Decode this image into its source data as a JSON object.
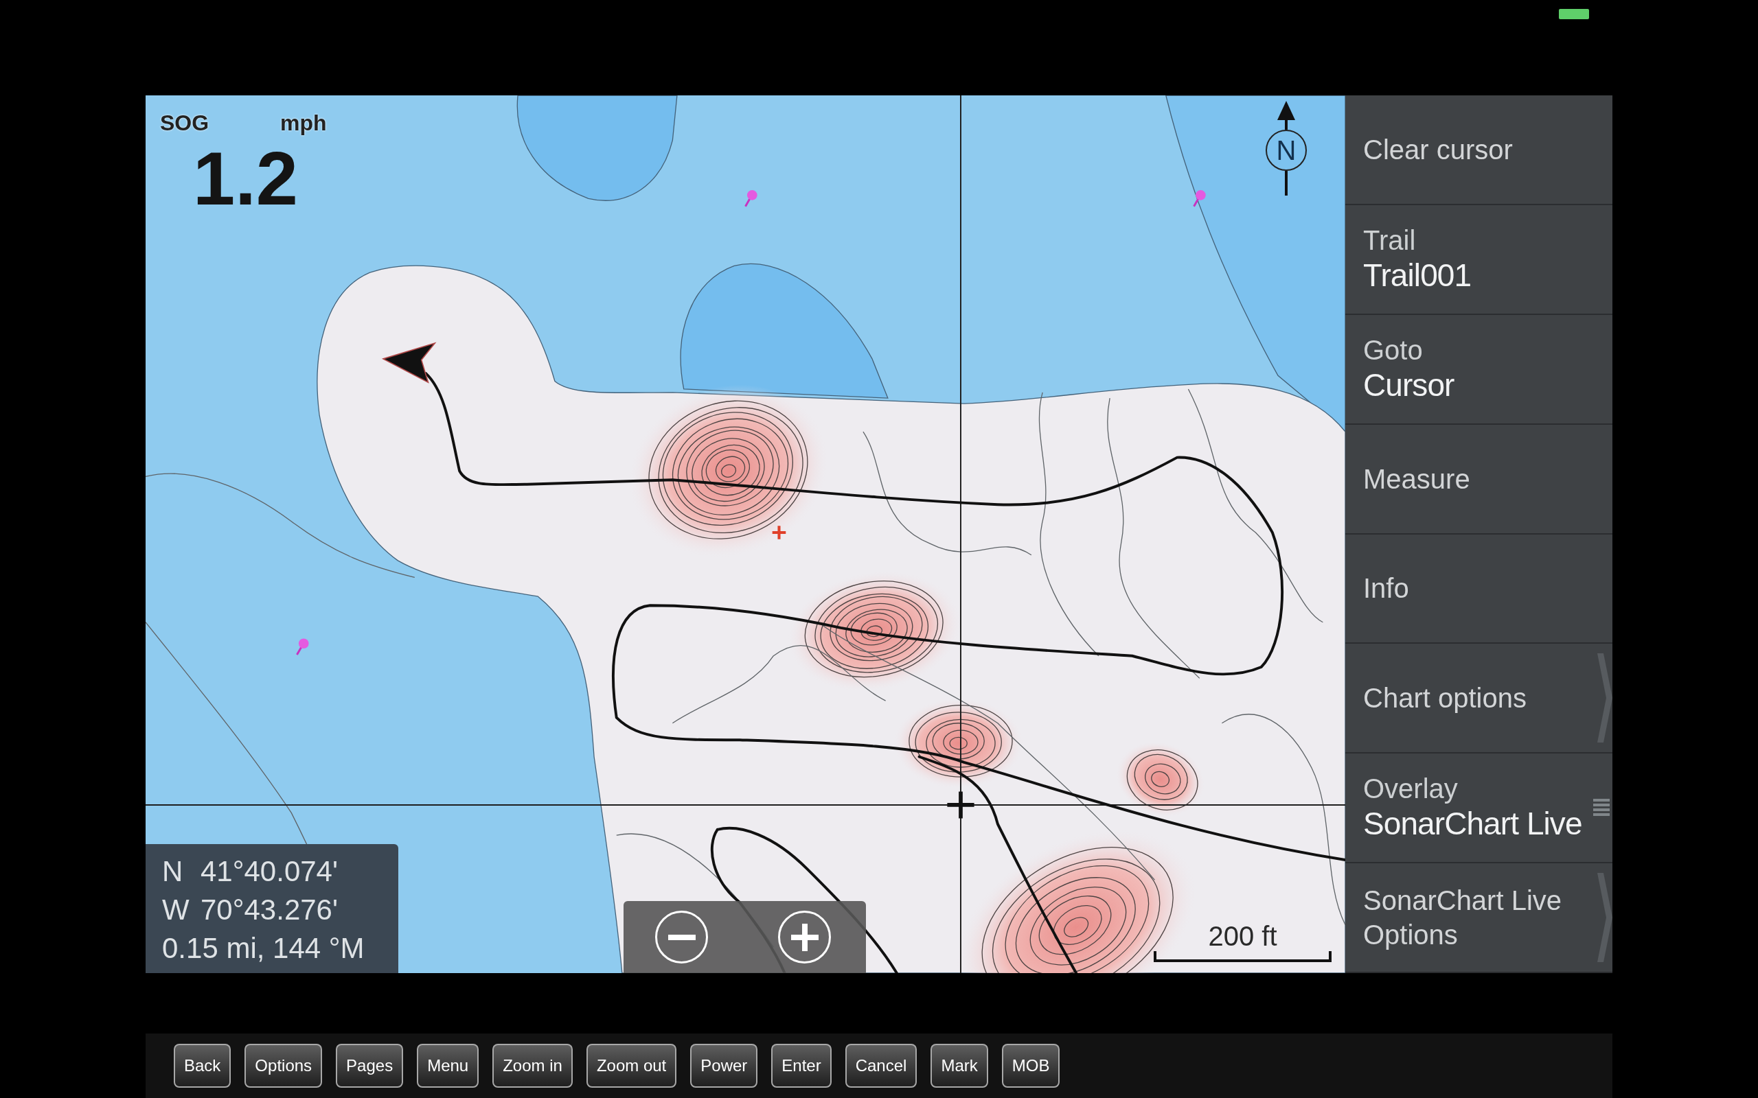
{
  "chart": {
    "speed_readout": {
      "label": "SOG",
      "unit": "mph",
      "value": "1.2"
    },
    "north_indicator": {
      "label": "N"
    },
    "position": {
      "latitude": {
        "hemisphere": "N",
        "value": "41°40.074'"
      },
      "longitude": {
        "hemisphere": "W",
        "value": "70°43.276'"
      },
      "range_bearing": "0.15 mi, 144 °M"
    },
    "zoom_controls": [
      {
        "kind": "zoom_out"
      },
      {
        "kind": "zoom_in"
      }
    ],
    "scale_bar": {
      "label": "200 ft"
    }
  },
  "menu": {
    "items": [
      {
        "kind": "action",
        "label": "Clear cursor",
        "submenu": false,
        "handle": false
      },
      {
        "kind": "setting",
        "label": "Trail",
        "value": "Trail001",
        "submenu": false,
        "handle": false
      },
      {
        "kind": "setting",
        "label": "Goto",
        "value": "Cursor",
        "submenu": false,
        "handle": false
      },
      {
        "kind": "action",
        "label": "Measure",
        "submenu": false,
        "handle": false
      },
      {
        "kind": "action",
        "label": "Info",
        "submenu": false,
        "handle": false
      },
      {
        "kind": "action",
        "label": "Chart options",
        "submenu": true,
        "handle": false
      },
      {
        "kind": "setting",
        "label": "Overlay",
        "value": "SonarChart Live",
        "submenu": false,
        "handle": true
      },
      {
        "kind": "action",
        "label": "SonarChart Live Options",
        "submenu": true,
        "handle": false
      }
    ]
  },
  "soft_keys": [
    "Back",
    "Options",
    "Pages",
    "Menu",
    "Zoom in",
    "Zoom out",
    "Power",
    "Enter",
    "Cancel",
    "Mark",
    "MOB"
  ]
}
